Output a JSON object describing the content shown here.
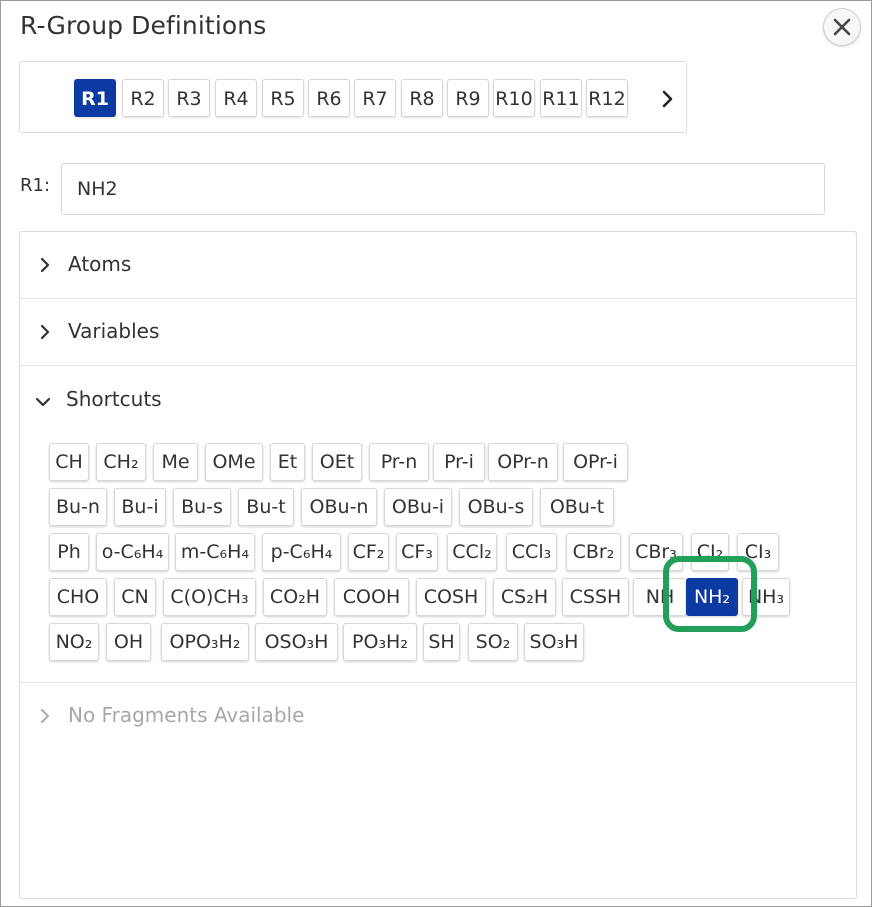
{
  "dialog": {
    "title": "R-Group Definitions"
  },
  "rgroup_tabs": [
    "R1",
    "R2",
    "R3",
    "R4",
    "R5",
    "R6",
    "R7",
    "R8",
    "R9",
    "R10",
    "R11",
    "R12"
  ],
  "rgroup_selected": "R1",
  "r1": {
    "label": "R1:",
    "value": "NH2"
  },
  "sections": {
    "atoms": "Atoms",
    "variables": "Variables",
    "shortcuts": "Shortcuts",
    "fragments": "No Fragments Available"
  },
  "shortcuts": {
    "rows": [
      [
        "CH",
        "CH₂",
        "Me",
        "OMe",
        "Et",
        "OEt",
        "Pr-n",
        "Pr-i",
        "OPr-n",
        "OPr-i"
      ],
      [
        "Bu-n",
        "Bu-i",
        "Bu-s",
        "Bu-t",
        "OBu-n",
        "OBu-i",
        "OBu-s",
        "OBu-t"
      ],
      [
        "Ph",
        "o-C₆H₄",
        "m-C₆H₄",
        "p-C₆H₄",
        "CF₂",
        "CF₃",
        "CCl₂",
        "CCl₃",
        "CBr₂",
        "CBr₃",
        "CI₂",
        "CI₃"
      ],
      [
        "CHO",
        "CN",
        "C(O)CH₃",
        "CO₂H",
        "COOH",
        "COSH",
        "CS₂H",
        "CSSH",
        "NH",
        "NH₂",
        "NH₃"
      ],
      [
        "NO₂",
        "OH",
        "OPO₃H₂",
        "OSO₃H",
        "PO₃H₂",
        "SH",
        "SO₂",
        "SO₃H"
      ]
    ],
    "selected": "NH₂"
  },
  "colors": {
    "accent": "#0b3aa3",
    "highlight": "#22a05a"
  }
}
